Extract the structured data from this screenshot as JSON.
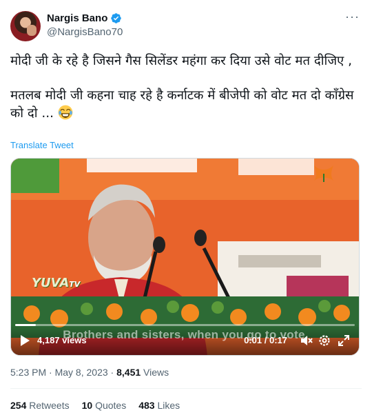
{
  "author": {
    "display_name": "Nargis Bano",
    "handle": "@NargisBano70",
    "verified": true
  },
  "tweet": {
    "line1": "मोदी जी के रहे है जिसने गैस सिलेंडर महंगा कर दिया उसे वोट मत दीजिए ,",
    "line2": "मतलब मोदी जी कहना चाह रहे है कर्नाटक में बीजेपी को वोट मत दो कॉंग्रेस को दो ...",
    "emoji": "face-with-tears-of-joy",
    "translate_label": "Translate Tweet"
  },
  "video": {
    "views_label": "4,187 views",
    "current_time": "0:01",
    "duration": "0:17",
    "progress": 0.06,
    "watermark": "YUVA",
    "watermark_suffix": "TV",
    "caption": "Brothers and sisters, when you go to vote,",
    "icons": [
      "play-icon",
      "mute-icon",
      "settings-icon",
      "fullscreen-icon"
    ]
  },
  "meta": {
    "time": "5:23 PM",
    "separator": "·",
    "date": "May 8, 2023",
    "views_count": "8,451",
    "views_label": "Views"
  },
  "stats": {
    "retweets_count": "254",
    "retweets_label": "Retweets",
    "quotes_count": "10",
    "quotes_label": "Quotes",
    "likes_count": "483",
    "likes_label": "Likes"
  },
  "colors": {
    "accent": "#1d9bf0",
    "secondary_text": "#536471",
    "primary_text": "#0f1419"
  }
}
